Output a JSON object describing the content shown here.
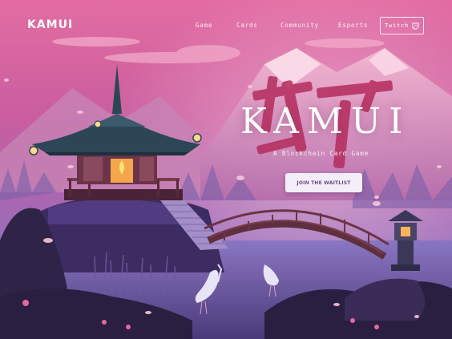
{
  "brand": {
    "logo": "KAMUI"
  },
  "nav": {
    "links": [
      {
        "label": "Game"
      },
      {
        "label": "Cards"
      },
      {
        "label": "Community"
      },
      {
        "label": "Esports"
      }
    ],
    "twitch": {
      "label": "Twitch",
      "icon": "twitch-icon"
    }
  },
  "hero": {
    "title": "KAMUI",
    "subtitle": "A Blockchain Card Game",
    "cta_label": "JOIN THE WAITLIST"
  },
  "colors": {
    "sky_top": "#e06aa0",
    "sky_mid": "#c45e9c",
    "mist": "#8f6fb8",
    "ground": "#3a2a55",
    "kanji": "#b52c5e",
    "cta_bg": "#f4eefa"
  }
}
